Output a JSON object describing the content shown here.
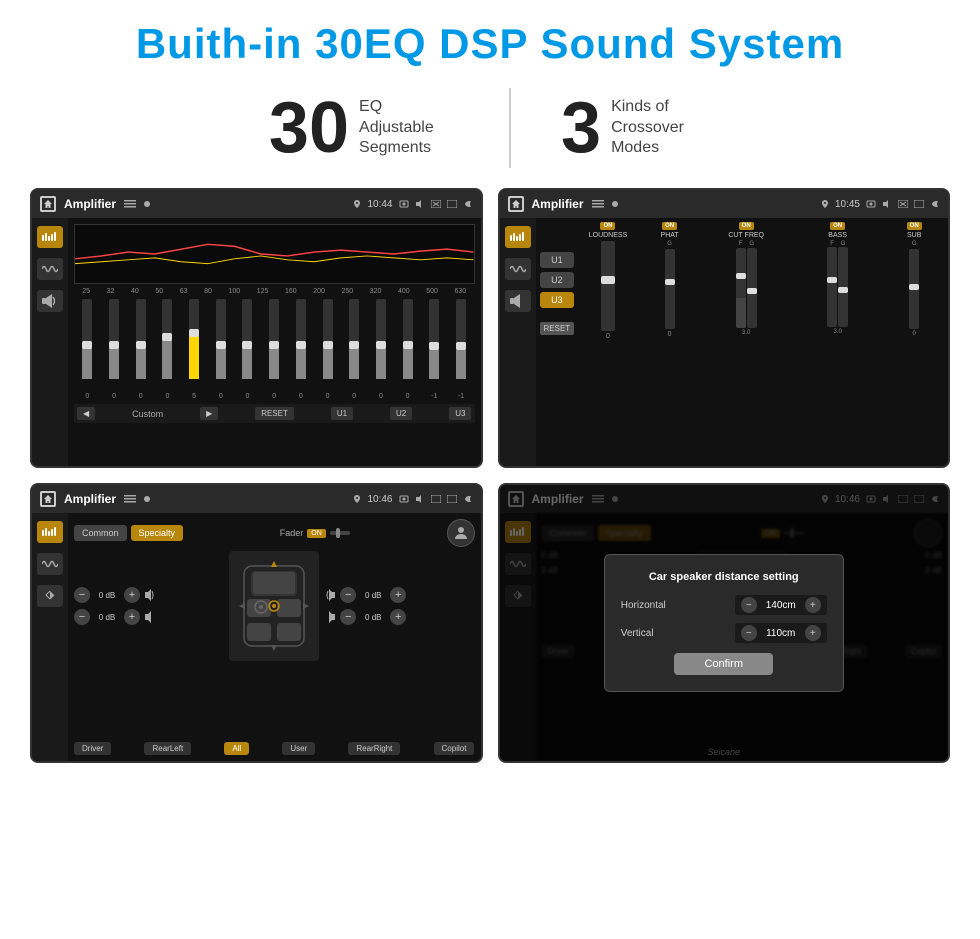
{
  "page": {
    "title": "Buith-in 30EQ DSP Sound System",
    "stat1_number": "30",
    "stat1_label": "EQ Adjustable\nSegments",
    "stat2_number": "3",
    "stat2_label": "Kinds of\nCrossover Modes"
  },
  "screens": {
    "screen1": {
      "title": "Amplifier",
      "time": "10:44",
      "eq_labels": [
        "25",
        "32",
        "40",
        "50",
        "63",
        "80",
        "100",
        "125",
        "160",
        "200",
        "250",
        "320",
        "400",
        "500",
        "630"
      ],
      "eq_values": [
        "0",
        "0",
        "0",
        "0",
        "5",
        "0",
        "0",
        "0",
        "0",
        "0",
        "0",
        "0",
        "0",
        "-1",
        "0",
        "-1"
      ],
      "bottom_text": "Custom",
      "buttons": [
        "RESET",
        "U1",
        "U2",
        "U3"
      ]
    },
    "screen2": {
      "title": "Amplifier",
      "time": "10:45",
      "channels": [
        "LOUDNESS",
        "PHAT",
        "CUT FREQ",
        "BASS",
        "SUB"
      ],
      "u_buttons": [
        "U1",
        "U2",
        "U3"
      ],
      "reset_label": "RESET"
    },
    "screen3": {
      "title": "Amplifier",
      "time": "10:46",
      "mode_buttons": [
        "Common",
        "Specialty"
      ],
      "fader_label": "Fader",
      "fader_state": "ON",
      "db_values": [
        "0 dB",
        "0 dB",
        "0 dB",
        "0 dB"
      ],
      "bottom_buttons": [
        "Driver",
        "RearLeft",
        "All",
        "User",
        "RearRight",
        "Copilot"
      ]
    },
    "screen4": {
      "title": "Amplifier",
      "time": "10:46",
      "mode_buttons": [
        "Common",
        "Specialty"
      ],
      "dialog": {
        "title": "Car speaker distance setting",
        "horizontal_label": "Horizontal",
        "horizontal_value": "140cm",
        "vertical_label": "Vertical",
        "vertical_value": "110cm",
        "confirm_label": "Confirm"
      },
      "db_values": [
        "0 dB",
        "0 dB"
      ],
      "bottom_buttons": [
        "Driver",
        "RearLeft",
        "All",
        "User",
        "RearRight",
        "Copilot"
      ]
    }
  },
  "watermark": "Seicane"
}
